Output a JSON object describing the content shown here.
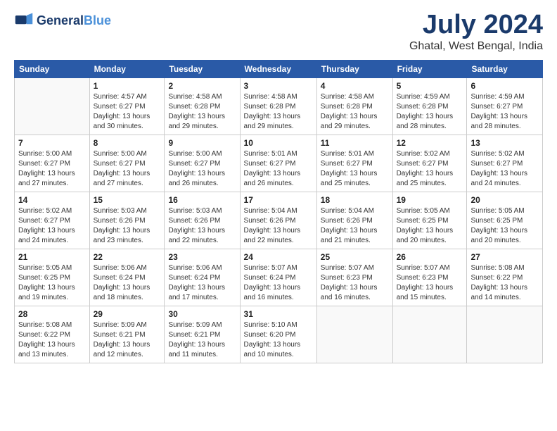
{
  "header": {
    "logo_text_main": "General",
    "logo_text_accent": "Blue",
    "month_title": "July 2024",
    "location": "Ghatal, West Bengal, India"
  },
  "weekdays": [
    "Sunday",
    "Monday",
    "Tuesday",
    "Wednesday",
    "Thursday",
    "Friday",
    "Saturday"
  ],
  "weeks": [
    [
      {
        "day": "",
        "sunrise": "",
        "sunset": "",
        "daylight": ""
      },
      {
        "day": "1",
        "sunrise": "Sunrise: 4:57 AM",
        "sunset": "Sunset: 6:27 PM",
        "daylight": "Daylight: 13 hours and 30 minutes."
      },
      {
        "day": "2",
        "sunrise": "Sunrise: 4:58 AM",
        "sunset": "Sunset: 6:28 PM",
        "daylight": "Daylight: 13 hours and 29 minutes."
      },
      {
        "day": "3",
        "sunrise": "Sunrise: 4:58 AM",
        "sunset": "Sunset: 6:28 PM",
        "daylight": "Daylight: 13 hours and 29 minutes."
      },
      {
        "day": "4",
        "sunrise": "Sunrise: 4:58 AM",
        "sunset": "Sunset: 6:28 PM",
        "daylight": "Daylight: 13 hours and 29 minutes."
      },
      {
        "day": "5",
        "sunrise": "Sunrise: 4:59 AM",
        "sunset": "Sunset: 6:28 PM",
        "daylight": "Daylight: 13 hours and 28 minutes."
      },
      {
        "day": "6",
        "sunrise": "Sunrise: 4:59 AM",
        "sunset": "Sunset: 6:27 PM",
        "daylight": "Daylight: 13 hours and 28 minutes."
      }
    ],
    [
      {
        "day": "7",
        "sunrise": "Sunrise: 5:00 AM",
        "sunset": "Sunset: 6:27 PM",
        "daylight": "Daylight: 13 hours and 27 minutes."
      },
      {
        "day": "8",
        "sunrise": "Sunrise: 5:00 AM",
        "sunset": "Sunset: 6:27 PM",
        "daylight": "Daylight: 13 hours and 27 minutes."
      },
      {
        "day": "9",
        "sunrise": "Sunrise: 5:00 AM",
        "sunset": "Sunset: 6:27 PM",
        "daylight": "Daylight: 13 hours and 26 minutes."
      },
      {
        "day": "10",
        "sunrise": "Sunrise: 5:01 AM",
        "sunset": "Sunset: 6:27 PM",
        "daylight": "Daylight: 13 hours and 26 minutes."
      },
      {
        "day": "11",
        "sunrise": "Sunrise: 5:01 AM",
        "sunset": "Sunset: 6:27 PM",
        "daylight": "Daylight: 13 hours and 25 minutes."
      },
      {
        "day": "12",
        "sunrise": "Sunrise: 5:02 AM",
        "sunset": "Sunset: 6:27 PM",
        "daylight": "Daylight: 13 hours and 25 minutes."
      },
      {
        "day": "13",
        "sunrise": "Sunrise: 5:02 AM",
        "sunset": "Sunset: 6:27 PM",
        "daylight": "Daylight: 13 hours and 24 minutes."
      }
    ],
    [
      {
        "day": "14",
        "sunrise": "Sunrise: 5:02 AM",
        "sunset": "Sunset: 6:27 PM",
        "daylight": "Daylight: 13 hours and 24 minutes."
      },
      {
        "day": "15",
        "sunrise": "Sunrise: 5:03 AM",
        "sunset": "Sunset: 6:26 PM",
        "daylight": "Daylight: 13 hours and 23 minutes."
      },
      {
        "day": "16",
        "sunrise": "Sunrise: 5:03 AM",
        "sunset": "Sunset: 6:26 PM",
        "daylight": "Daylight: 13 hours and 22 minutes."
      },
      {
        "day": "17",
        "sunrise": "Sunrise: 5:04 AM",
        "sunset": "Sunset: 6:26 PM",
        "daylight": "Daylight: 13 hours and 22 minutes."
      },
      {
        "day": "18",
        "sunrise": "Sunrise: 5:04 AM",
        "sunset": "Sunset: 6:26 PM",
        "daylight": "Daylight: 13 hours and 21 minutes."
      },
      {
        "day": "19",
        "sunrise": "Sunrise: 5:05 AM",
        "sunset": "Sunset: 6:25 PM",
        "daylight": "Daylight: 13 hours and 20 minutes."
      },
      {
        "day": "20",
        "sunrise": "Sunrise: 5:05 AM",
        "sunset": "Sunset: 6:25 PM",
        "daylight": "Daylight: 13 hours and 20 minutes."
      }
    ],
    [
      {
        "day": "21",
        "sunrise": "Sunrise: 5:05 AM",
        "sunset": "Sunset: 6:25 PM",
        "daylight": "Daylight: 13 hours and 19 minutes."
      },
      {
        "day": "22",
        "sunrise": "Sunrise: 5:06 AM",
        "sunset": "Sunset: 6:24 PM",
        "daylight": "Daylight: 13 hours and 18 minutes."
      },
      {
        "day": "23",
        "sunrise": "Sunrise: 5:06 AM",
        "sunset": "Sunset: 6:24 PM",
        "daylight": "Daylight: 13 hours and 17 minutes."
      },
      {
        "day": "24",
        "sunrise": "Sunrise: 5:07 AM",
        "sunset": "Sunset: 6:24 PM",
        "daylight": "Daylight: 13 hours and 16 minutes."
      },
      {
        "day": "25",
        "sunrise": "Sunrise: 5:07 AM",
        "sunset": "Sunset: 6:23 PM",
        "daylight": "Daylight: 13 hours and 16 minutes."
      },
      {
        "day": "26",
        "sunrise": "Sunrise: 5:07 AM",
        "sunset": "Sunset: 6:23 PM",
        "daylight": "Daylight: 13 hours and 15 minutes."
      },
      {
        "day": "27",
        "sunrise": "Sunrise: 5:08 AM",
        "sunset": "Sunset: 6:22 PM",
        "daylight": "Daylight: 13 hours and 14 minutes."
      }
    ],
    [
      {
        "day": "28",
        "sunrise": "Sunrise: 5:08 AM",
        "sunset": "Sunset: 6:22 PM",
        "daylight": "Daylight: 13 hours and 13 minutes."
      },
      {
        "day": "29",
        "sunrise": "Sunrise: 5:09 AM",
        "sunset": "Sunset: 6:21 PM",
        "daylight": "Daylight: 13 hours and 12 minutes."
      },
      {
        "day": "30",
        "sunrise": "Sunrise: 5:09 AM",
        "sunset": "Sunset: 6:21 PM",
        "daylight": "Daylight: 13 hours and 11 minutes."
      },
      {
        "day": "31",
        "sunrise": "Sunrise: 5:10 AM",
        "sunset": "Sunset: 6:20 PM",
        "daylight": "Daylight: 13 hours and 10 minutes."
      },
      {
        "day": "",
        "sunrise": "",
        "sunset": "",
        "daylight": ""
      },
      {
        "day": "",
        "sunrise": "",
        "sunset": "",
        "daylight": ""
      },
      {
        "day": "",
        "sunrise": "",
        "sunset": "",
        "daylight": ""
      }
    ]
  ]
}
